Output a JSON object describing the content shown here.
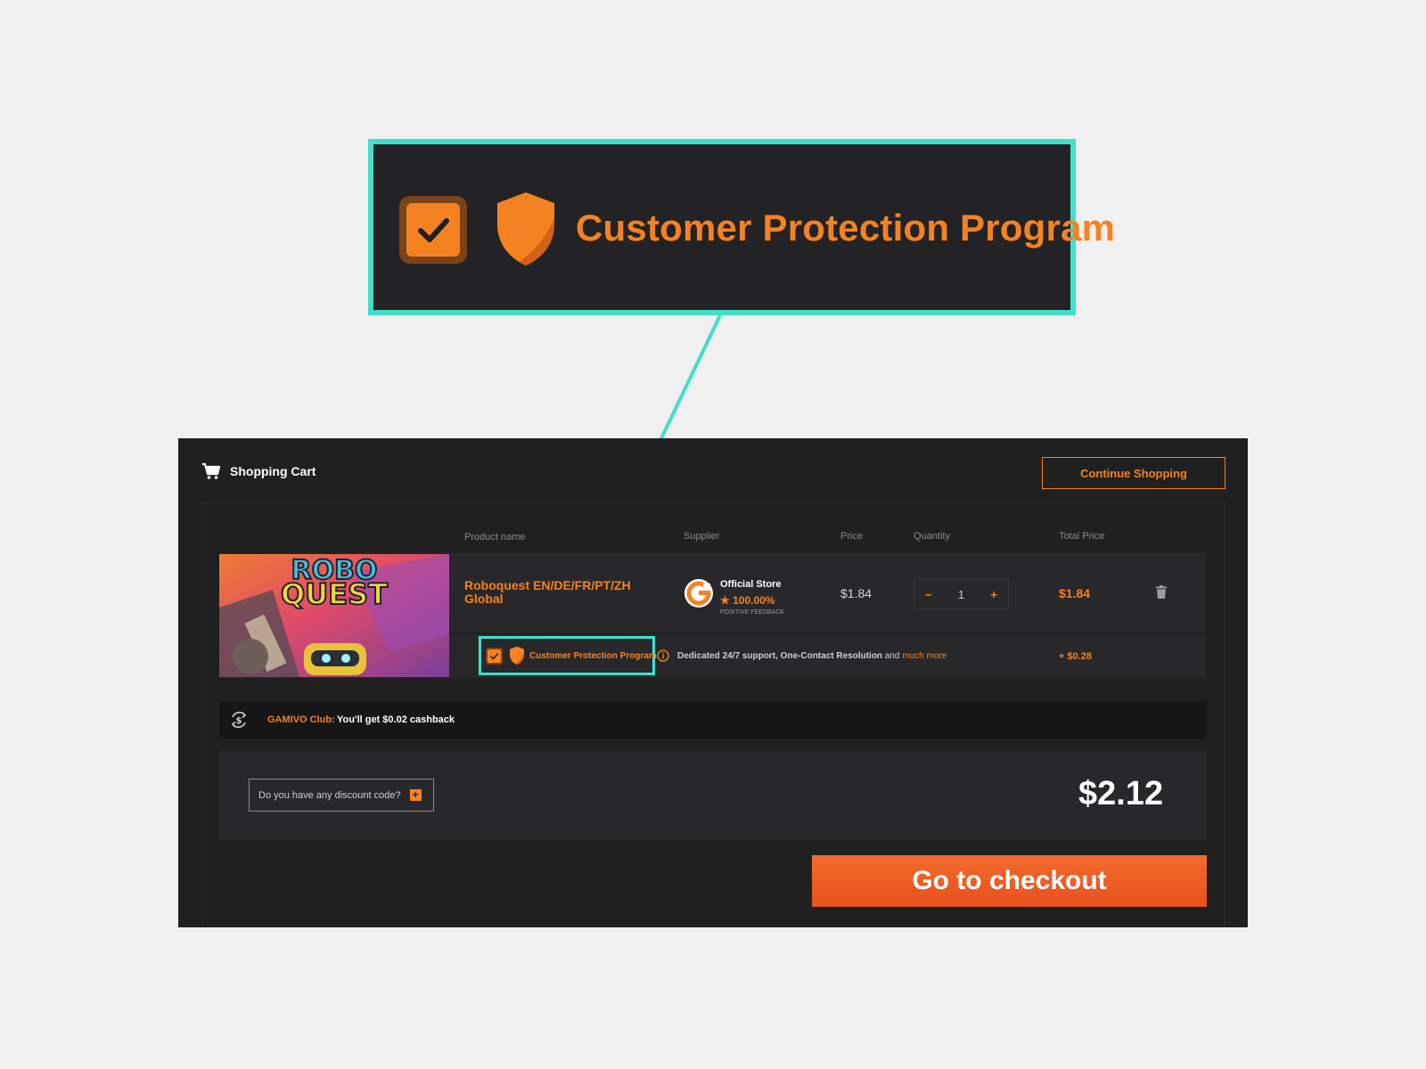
{
  "zoom": {
    "label": "Customer Protection Program"
  },
  "header": {
    "title": "Shopping Cart",
    "continue_label": "Continue Shopping"
  },
  "columns": {
    "product": "Product name",
    "supplier": "Supplier",
    "price": "Price",
    "quantity": "Quantity",
    "total": "Total Price"
  },
  "item": {
    "thumbnail_text": [
      "ROBO",
      "QUEST"
    ],
    "name": "Roboquest EN/DE/FR/PT/ZH Global",
    "supplier": {
      "name": "Official Store",
      "rating": "★ 100.00%",
      "feedback_label": "POSITIVE FEEDBACK",
      "logo_letter": "G"
    },
    "price": "$1.84",
    "quantity": "1",
    "quantity_minus": "−",
    "quantity_plus": "+",
    "total": "$1.84"
  },
  "protection": {
    "label": "Customer Protection Program",
    "checked": true,
    "description": "Dedicated 24/7 support, One-Contact Resolution",
    "description_and": " and ",
    "more_link": "much more",
    "price": "+ $0.28"
  },
  "club": {
    "name": "GAMIVO Club:",
    "text": "You'll get $0.02 cashback"
  },
  "summary": {
    "discount_label": "Do you have any discount code?",
    "discount_plus": "+",
    "grand_total": "$2.12"
  },
  "checkout": {
    "label": "Go to checkout"
  },
  "colors": {
    "accent": "#f58220",
    "highlight": "#40dfca",
    "panel": "#202020",
    "row": "#28282b"
  }
}
